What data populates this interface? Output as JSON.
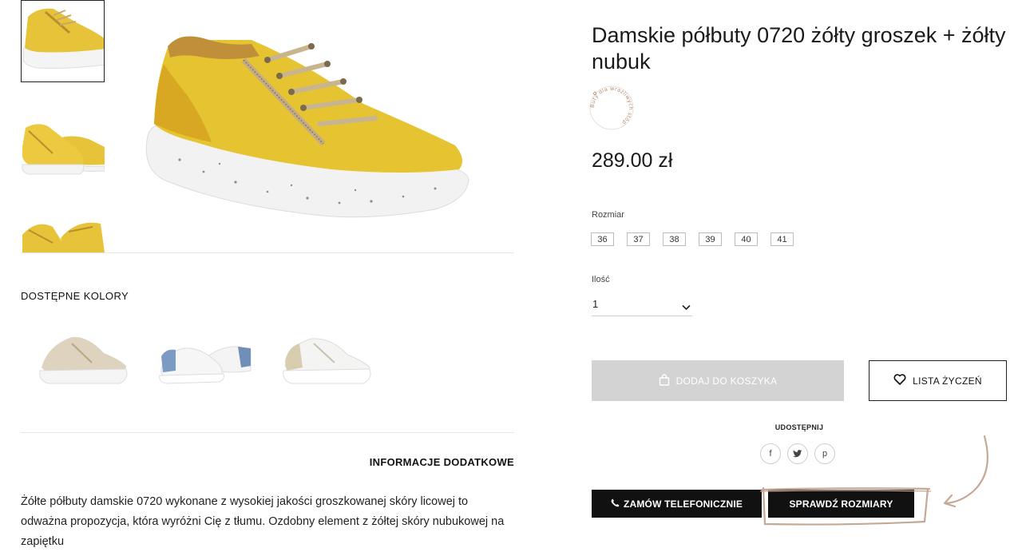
{
  "gallery": {
    "thumbnails": [
      "yellow-shoe-side",
      "yellow-shoe-pair",
      "yellow-shoe-top"
    ],
    "main_image": "yellow-sneaker"
  },
  "colors": {
    "title": "DOSTĘPNE KOLORY",
    "options": [
      "beige-sneaker",
      "white-blue-sneaker",
      "white-beige-sneaker"
    ]
  },
  "info": {
    "title": "INFORMACJE DODATKOWE",
    "description": "Żółte półbuty damskie 0720 wykonane z wysokiej jakości groszkowanej skóry licowej to odważna propozycja, która wyróżni Cię z tłumu. Ozdobny element z żółtej skóry nubukowej na zapiętku"
  },
  "product": {
    "title": "Damskie półbuty 0720 żółty groszek + żółty nubuk",
    "badge_text": "Buty dla wrażliwych stóp",
    "price": "289.00 zł",
    "size_label": "Rozmiar",
    "sizes": [
      "36",
      "37",
      "38",
      "39",
      "40",
      "41"
    ],
    "qty_label": "Ilość",
    "qty_value": "1"
  },
  "actions": {
    "add_to_cart": "DODAJ DO KOSZYKA",
    "wishlist": "LISTA ŻYCZEŃ",
    "share_title": "UDOSTĘPNIJ",
    "share": [
      "f",
      "t",
      "p"
    ],
    "order_phone": "ZAMÓW TELEFONICZNIE",
    "check_sizes": "SPRAWDŹ ROZMIARY"
  },
  "colors_palette": {
    "accent_disabled": "#d3d3d3",
    "dark": "#111111",
    "sketch": "#c5a895"
  }
}
